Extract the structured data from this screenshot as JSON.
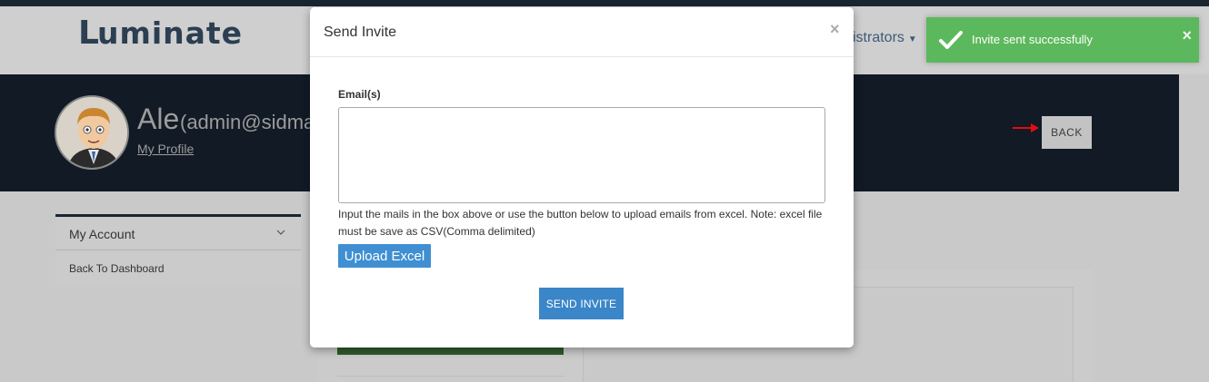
{
  "brand": {
    "logo_text": "uminate",
    "logo_mark": "L"
  },
  "header": {
    "nav_admin_label": "istrators"
  },
  "profile": {
    "name": "Ale",
    "email": "(admin@sidmac",
    "link_label": "My Profile",
    "back_label": "BACK"
  },
  "sidebar": {
    "title": "My Account",
    "items": [
      {
        "label": "Back To Dashboard"
      }
    ]
  },
  "toast": {
    "message": "Invite sent successfully",
    "close_symbol": "×",
    "color": "#5cb85c"
  },
  "modal": {
    "title": "Send Invite",
    "close_symbol": "×",
    "email_label": "Email(s)",
    "email_value": "",
    "help_text": "Input the mails in the box above or use the button below to upload emails from excel. Note: excel file must be save as CSV(Comma delimited)",
    "upload_label": "Upload Excel",
    "send_label": "SEND INVITE",
    "accent": "#3a86c8"
  },
  "icons": {
    "toast": "checkmark-icon",
    "sidebar": "chevron-down-icon",
    "annotation": "red-arrow-icon",
    "avatar": "cartoon-avatar-icon"
  }
}
